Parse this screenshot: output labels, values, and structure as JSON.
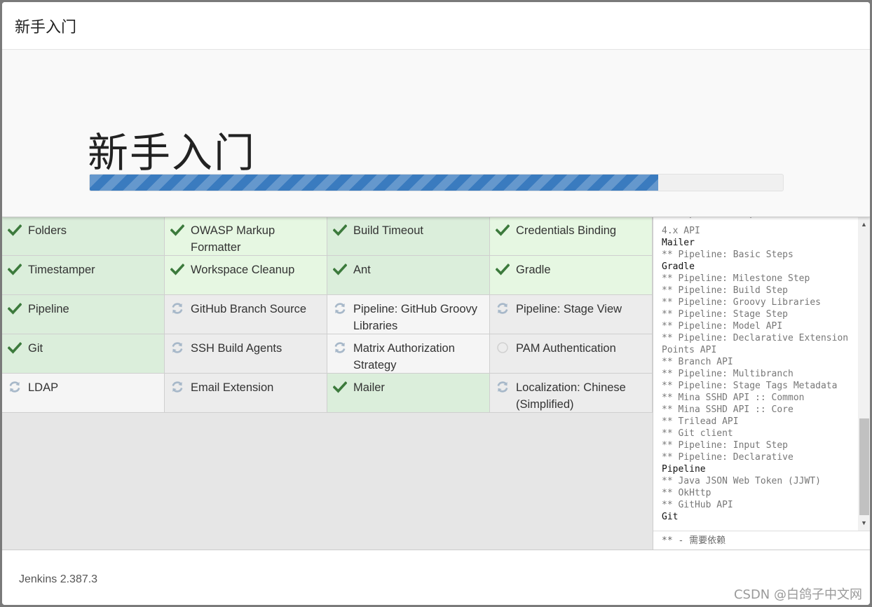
{
  "header": {
    "title": "新手入门"
  },
  "hero": {
    "heading": "新手入门",
    "progress_percent": 82
  },
  "plugins": [
    {
      "name": "Folders",
      "status": "success"
    },
    {
      "name": "OWASP Markup Formatter",
      "status": "success"
    },
    {
      "name": "Build Timeout",
      "status": "success"
    },
    {
      "name": "Credentials Binding",
      "status": "success"
    },
    {
      "name": "Timestamper",
      "status": "success"
    },
    {
      "name": "Workspace Cleanup",
      "status": "success"
    },
    {
      "name": "Ant",
      "status": "success"
    },
    {
      "name": "Gradle",
      "status": "success"
    },
    {
      "name": "Pipeline",
      "status": "success"
    },
    {
      "name": "GitHub Branch Source",
      "status": "installing"
    },
    {
      "name": "Pipeline: GitHub Groovy Libraries",
      "status": "installing"
    },
    {
      "name": "Pipeline: Stage View",
      "status": "installing"
    },
    {
      "name": "Git",
      "status": "success"
    },
    {
      "name": "SSH Build Agents",
      "status": "installing"
    },
    {
      "name": "Matrix Authorization Strategy",
      "status": "installing"
    },
    {
      "name": "PAM Authentication",
      "status": "pending"
    },
    {
      "name": "LDAP",
      "status": "installing"
    },
    {
      "name": "Email Extension",
      "status": "installing"
    },
    {
      "name": "Mailer",
      "status": "success"
    },
    {
      "name": "Localization: Chinese (Simplified)",
      "status": "installing"
    }
  ],
  "log": {
    "lines": [
      {
        "text": "4.x API",
        "bold": false
      },
      {
        "text": "Mailer",
        "bold": true
      },
      {
        "text": "** Pipeline: Basic Steps",
        "bold": false
      },
      {
        "text": "Gradle",
        "bold": true
      },
      {
        "text": "** Pipeline: Milestone Step",
        "bold": false
      },
      {
        "text": "** Pipeline: Build Step",
        "bold": false
      },
      {
        "text": "** Pipeline: Groovy Libraries",
        "bold": false
      },
      {
        "text": "** Pipeline: Stage Step",
        "bold": false
      },
      {
        "text": "** Pipeline: Model API",
        "bold": false
      },
      {
        "text": "** Pipeline: Declarative Extension Points API",
        "bold": false
      },
      {
        "text": "** Branch API",
        "bold": false
      },
      {
        "text": "** Pipeline: Multibranch",
        "bold": false
      },
      {
        "text": "** Pipeline: Stage Tags Metadata",
        "bold": false
      },
      {
        "text": "** Mina SSHD API :: Common",
        "bold": false
      },
      {
        "text": "** Mina SSHD API :: Core",
        "bold": false
      },
      {
        "text": "** Trilead API",
        "bold": false
      },
      {
        "text": "** Git client",
        "bold": false
      },
      {
        "text": "** Pipeline: Input Step",
        "bold": false
      },
      {
        "text": "** Pipeline: Declarative",
        "bold": false
      },
      {
        "text": "Pipeline",
        "bold": true
      },
      {
        "text": "** Java JSON Web Token (JJWT)",
        "bold": false
      },
      {
        "text": "** OkHttp",
        "bold": false
      },
      {
        "text": "** GitHub API",
        "bold": false
      },
      {
        "text": "Git",
        "bold": true
      }
    ],
    "legend": "** - 需要依赖"
  },
  "footer": {
    "version": "Jenkins 2.387.3"
  },
  "watermark": "CSDN @白鸽子中文网",
  "colors": {
    "success_bg": "#dbeedb",
    "check": "#3c7a3c",
    "spinner": "#9fb3c8",
    "progress": "#3a7bbf"
  },
  "icons": {
    "success": "check-icon",
    "installing": "refresh-icon",
    "pending": "circle-icon"
  }
}
